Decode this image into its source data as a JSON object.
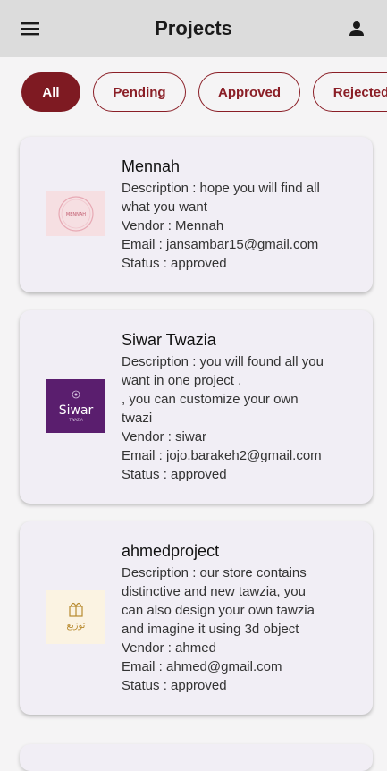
{
  "header": {
    "title": "Projects",
    "menu_icon": "menu-icon",
    "profile_icon": "person-icon"
  },
  "filters": [
    {
      "label": "All",
      "active": true
    },
    {
      "label": "Pending",
      "active": false
    },
    {
      "label": "Approved",
      "active": false
    },
    {
      "label": "Rejected",
      "active": false
    }
  ],
  "colors": {
    "accent": "#7e1a22",
    "appbar": "#dcdcdc",
    "card": "#f1eef5"
  },
  "projects": [
    {
      "name": "Mennah",
      "description": "Description : hope you will find all\nwhat you want",
      "vendor": "Vendor : Mennah",
      "email": "Email : jansambar15@gmail.com",
      "status": "Status : approved",
      "logo_text": "MENNAH"
    },
    {
      "name": "Siwar Twazia",
      "description": "Description : you will found all you\nwant in one project ,\n, you can customize your own\ntwazi",
      "vendor": "Vendor : siwar",
      "email": "Email : jojo.barakeh2@gmail.com",
      "status": "Status : approved",
      "logo_text": "Siwar",
      "logo_subtext": "TWAZIA"
    },
    {
      "name": "ahmedproject",
      "description": "Description : our store contains\ndistinctive and new tawzia, you\ncan also design your own tawzia\nand imagine it using 3d object",
      "vendor": "Vendor : ahmed",
      "email": "Email : ahmed@gmail.com",
      "status": "Status : approved",
      "logo_text": "توزيع"
    }
  ]
}
